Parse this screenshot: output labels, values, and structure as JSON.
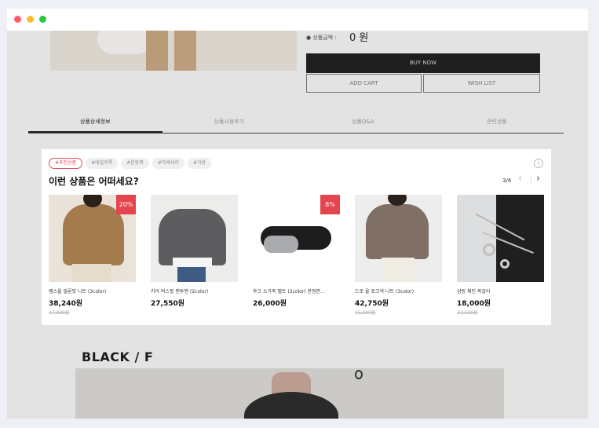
{
  "window": {
    "controls": [
      "close",
      "minimize",
      "maximize"
    ]
  },
  "product_page": {
    "price_label": "● 상품금액 :",
    "price_value": "0 원",
    "buy_now": "BUY NOW",
    "add_cart": "ADD CART",
    "wish_list": "WISH LIST",
    "tabs": [
      "상품상세정보",
      "상품사용후기",
      "상품Q&A",
      "관련상품"
    ],
    "section_heading": "BLACK / F"
  },
  "recommend": {
    "tags": [
      "#추천상품",
      "#데일리룩",
      "#운동복",
      "#악세서리",
      "#가방"
    ],
    "heading": "이런 상품은 어떠세요?",
    "page_indicator": "3/4",
    "prev": "‹",
    "next": "›",
    "info": "i",
    "products": [
      {
        "name": "램스울 벌룬핏 니트 (3color)",
        "price": "38,240원",
        "original": "47,800원",
        "badge": "20%"
      },
      {
        "name": "카이 박스핏 맨투맨 (2color)",
        "price": "27,550원",
        "original": "",
        "badge": ""
      },
      {
        "name": "후크 소가죽 벨트 (2color) 한정판...",
        "price": "26,000원",
        "original": "",
        "badge": "8%"
      },
      {
        "name": "드로 울 포크넥 니트 (3color)",
        "price": "42,750원",
        "original": "45,000원",
        "badge": ""
      },
      {
        "name": "샴링 체인 목걸이",
        "price": "18,000원",
        "original": "27,100원",
        "badge": ""
      }
    ]
  },
  "colors": {
    "accent": "#e5454f",
    "buy_button": "#1f1f1f"
  }
}
